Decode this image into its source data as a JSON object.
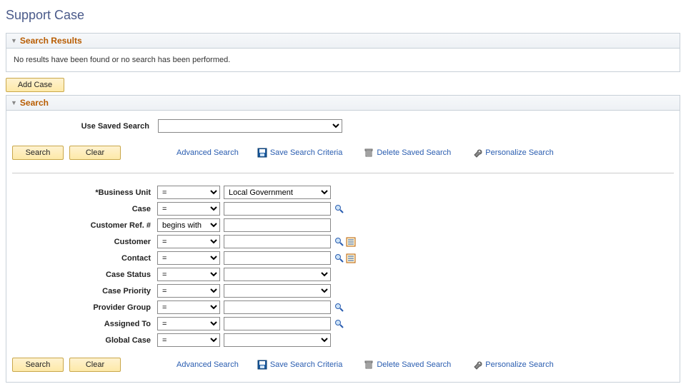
{
  "page_title": "Support Case",
  "results": {
    "header": "Search Results",
    "message": "No results have been found or no search has been performed."
  },
  "add_case_label": "Add Case",
  "search": {
    "header": "Search",
    "saved_label": "Use Saved Search",
    "saved_value": "",
    "buttons": {
      "search": "Search",
      "clear": "Clear"
    },
    "links": {
      "advanced": "Advanced Search",
      "save_criteria": "Save Search Criteria",
      "delete_saved": "Delete Saved Search",
      "personalize": "Personalize Search"
    },
    "fields": {
      "business_unit": {
        "label": "*Business Unit",
        "op": "=",
        "val": "Local Government",
        "type": "select"
      },
      "case": {
        "label": "Case",
        "op": "=",
        "val": "",
        "type": "text",
        "lookup": true
      },
      "cust_ref": {
        "label": "Customer Ref. #",
        "op": "begins with",
        "val": "",
        "type": "text"
      },
      "customer": {
        "label": "Customer",
        "op": "=",
        "val": "",
        "type": "text",
        "lookup": true,
        "detail": true
      },
      "contact": {
        "label": "Contact",
        "op": "=",
        "val": "",
        "type": "text",
        "lookup": true,
        "detail": true
      },
      "case_status": {
        "label": "Case Status",
        "op": "=",
        "val": "",
        "type": "select"
      },
      "case_priority": {
        "label": "Case Priority",
        "op": "=",
        "val": "",
        "type": "select"
      },
      "provider_group": {
        "label": "Provider Group",
        "op": "=",
        "val": "",
        "type": "text",
        "lookup": true
      },
      "assigned_to": {
        "label": "Assigned To",
        "op": "=",
        "val": "",
        "type": "text",
        "lookup": true
      },
      "global_case": {
        "label": "Global Case",
        "op": "=",
        "val": "",
        "type": "select"
      }
    }
  }
}
